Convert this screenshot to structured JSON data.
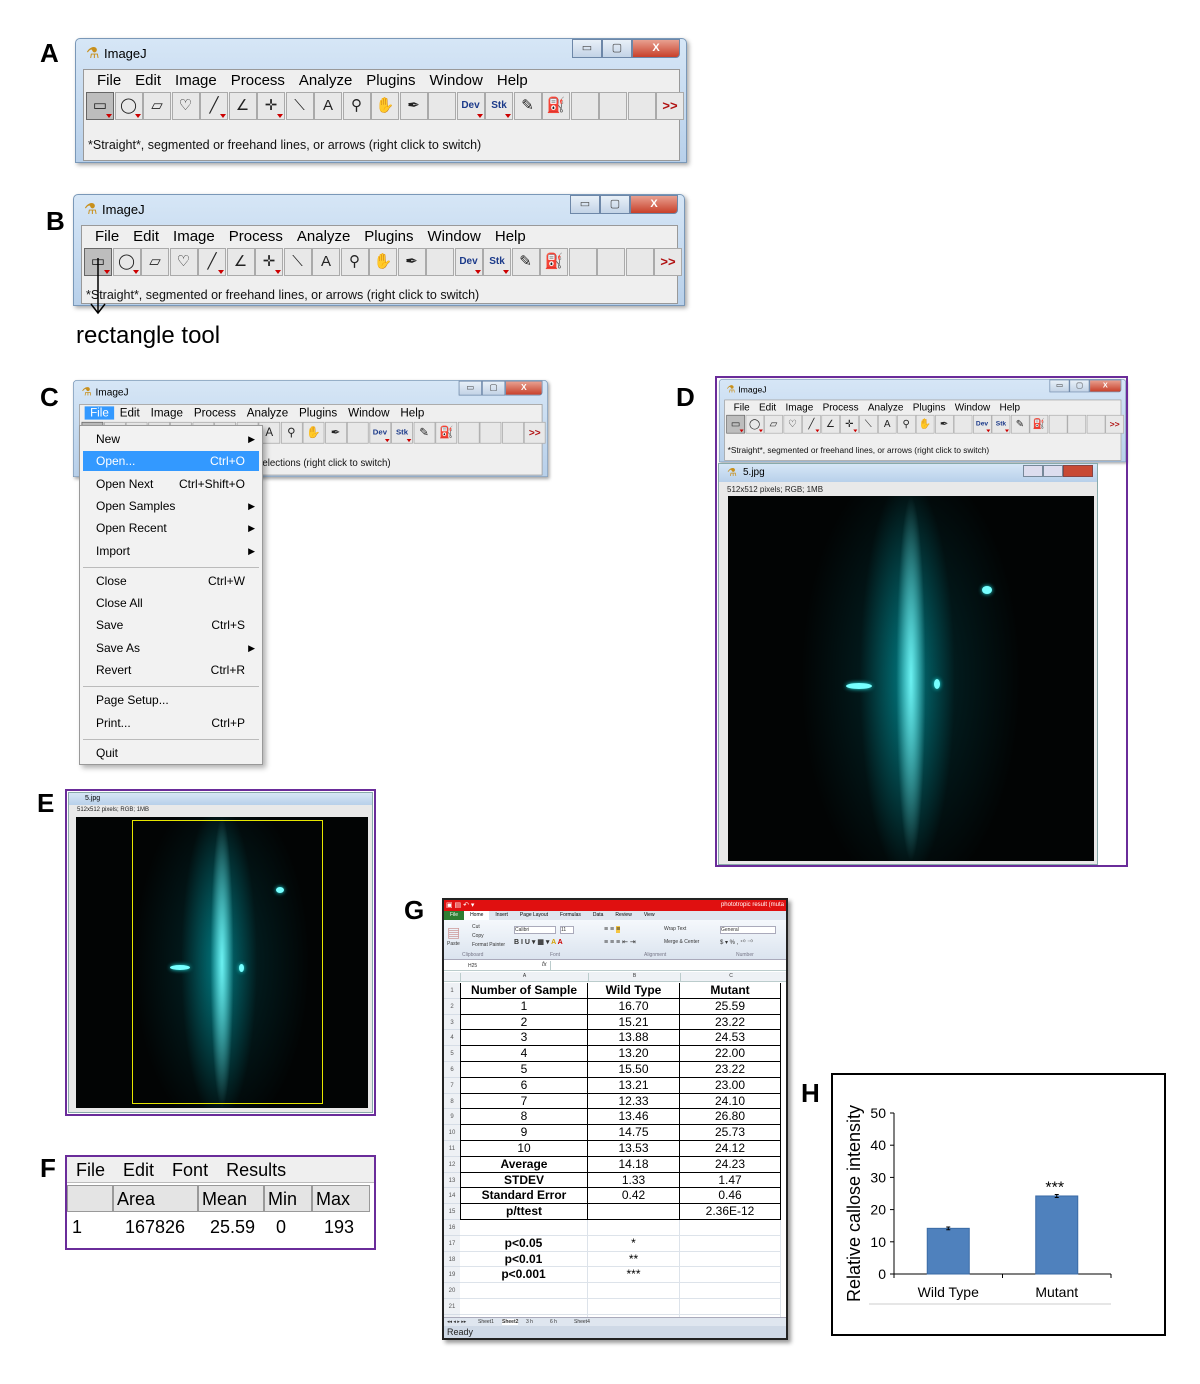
{
  "panel_labels": [
    "A",
    "B",
    "C",
    "D",
    "E",
    "G",
    "F",
    "H"
  ],
  "imagej": {
    "title": "ImageJ",
    "menu": [
      "File",
      "Edit",
      "Image",
      "Process",
      "Analyze",
      "Plugins",
      "Window",
      "Help"
    ],
    "window_buttons": {
      "minimize": "▭",
      "maximize": "▢",
      "close": "X"
    },
    "tools": [
      {
        "icon": "rectangle-icon",
        "glyph": "▭",
        "sub": true
      },
      {
        "icon": "oval-icon",
        "glyph": "◯",
        "sub": true
      },
      {
        "icon": "polygon-icon",
        "glyph": "▱"
      },
      {
        "icon": "freehand-icon",
        "glyph": "♡"
      },
      {
        "icon": "line-icon",
        "glyph": "╱",
        "sub": true
      },
      {
        "icon": "angle-icon",
        "glyph": "∠"
      },
      {
        "icon": "point-icon",
        "glyph": "✛",
        "sub": true
      },
      {
        "icon": "wand-icon",
        "glyph": "⟍"
      },
      {
        "icon": "text-icon",
        "glyph": "A"
      },
      {
        "icon": "magnifier-icon",
        "glyph": "⚲"
      },
      {
        "icon": "hand-icon",
        "glyph": "✋"
      },
      {
        "icon": "dropper-icon",
        "glyph": "✒"
      },
      {
        "icon": "blank-icon",
        "glyph": ""
      },
      {
        "icon": "dev-icon",
        "glyph": "Dev",
        "small": true,
        "sub": true
      },
      {
        "icon": "stk-icon",
        "glyph": "Stk",
        "small": true,
        "sub": true
      },
      {
        "icon": "brush-icon",
        "glyph": "✎"
      },
      {
        "icon": "bucket-icon",
        "glyph": "⛽"
      },
      {
        "icon": "blank-icon",
        "glyph": ""
      },
      {
        "icon": "blank-icon",
        "glyph": ""
      },
      {
        "icon": "blank-icon",
        "glyph": ""
      },
      {
        "icon": "more-tools-icon",
        "glyph": ">>",
        "red": true
      }
    ],
    "status": "*Straight*, segmented or freehand lines, or arrows (right click to switch)",
    "status_partial": "elections (right click to switch)"
  },
  "panel_b": {
    "annotation": "rectangle tool"
  },
  "file_menu": {
    "items": [
      {
        "label": "New",
        "shortcut": "",
        "submenu": true
      },
      {
        "label": "Open...",
        "shortcut": "Ctrl+O",
        "highlighted": true
      },
      {
        "label": "Open Next",
        "shortcut": "Ctrl+Shift+O"
      },
      {
        "label": "Open Samples",
        "shortcut": "",
        "submenu": true
      },
      {
        "label": "Open Recent",
        "shortcut": "",
        "submenu": true
      },
      {
        "label": "Import",
        "shortcut": "",
        "submenu": true
      },
      {
        "sep": true
      },
      {
        "label": "Close",
        "shortcut": "Ctrl+W"
      },
      {
        "label": "Close All",
        "shortcut": ""
      },
      {
        "label": "Save",
        "shortcut": "Ctrl+S"
      },
      {
        "label": "Save As",
        "shortcut": "",
        "submenu": true
      },
      {
        "label": "Revert",
        "shortcut": "Ctrl+R"
      },
      {
        "sep": true
      },
      {
        "label": "Page Setup...",
        "shortcut": ""
      },
      {
        "label": "Print...",
        "shortcut": "Ctrl+P"
      },
      {
        "sep": true
      },
      {
        "label": "Quit",
        "shortcut": ""
      }
    ]
  },
  "image_window": {
    "title": "5.jpg",
    "info": "512x512 pixels; RGB; 1MB"
  },
  "results": {
    "menu": [
      "File",
      "Edit",
      "Font",
      "Results"
    ],
    "headers": [
      "",
      "Area",
      "Mean",
      "Min",
      "Max"
    ],
    "rows": [
      [
        "1",
        "167826",
        "25.59",
        "0",
        "193"
      ]
    ]
  },
  "excel": {
    "title": "phototropic result (muta",
    "tabs": [
      "File",
      "Home",
      "Insert",
      "Page Layout",
      "Formulas",
      "Data",
      "Review",
      "View"
    ],
    "ribbon": {
      "paste": "Paste",
      "cut": "Cut",
      "copy": "Copy",
      "format_painter": "Format Painter",
      "clipboard": "Clipboard",
      "font_name": "Calibri",
      "font_size": "11",
      "font": "Font",
      "wrap": "Wrap Text",
      "merge": "Merge & Center",
      "alignment": "Alignment",
      "number_format": "General",
      "number": "Number"
    },
    "name_box": "H25",
    "fx": "fx",
    "columns": [
      "A",
      "B",
      "C"
    ],
    "rows": [
      [
        "Number of Sample",
        "Wild Type",
        "Mutant"
      ],
      [
        "1",
        "16.70",
        "25.59"
      ],
      [
        "2",
        "15.21",
        "23.22"
      ],
      [
        "3",
        "13.88",
        "24.53"
      ],
      [
        "4",
        "13.20",
        "22.00"
      ],
      [
        "5",
        "15.50",
        "23.22"
      ],
      [
        "6",
        "13.21",
        "23.00"
      ],
      [
        "7",
        "12.33",
        "24.10"
      ],
      [
        "8",
        "13.46",
        "26.80"
      ],
      [
        "9",
        "14.75",
        "25.73"
      ],
      [
        "10",
        "13.53",
        "24.12"
      ],
      [
        "Average",
        "14.18",
        "24.23"
      ],
      [
        "STDEV",
        "1.33",
        "1.47"
      ],
      [
        "Standard Error",
        "0.42",
        "0.46"
      ],
      [
        "p/ttest",
        "",
        "2.36E-12"
      ],
      [
        "",
        "",
        ""
      ],
      [
        "p<0.05",
        "*",
        ""
      ],
      [
        "p<0.01",
        "**",
        ""
      ],
      [
        "p<0.001",
        "***",
        ""
      ],
      [
        "",
        "",
        ""
      ],
      [
        "",
        "",
        ""
      ],
      [
        "",
        "",
        ""
      ]
    ],
    "sheets": [
      "Sheet1",
      "Sheet2",
      "3 h",
      "6 h",
      "Sheet4"
    ],
    "active_sheet": "Sheet2",
    "status": "Ready"
  },
  "chart_data": {
    "type": "bar",
    "categories": [
      "Wild Type",
      "Mutant"
    ],
    "values": [
      14.18,
      24.23
    ],
    "errors": [
      0.42,
      0.46
    ],
    "annotations": [
      "",
      "***"
    ],
    "ylabel": "Relative callose intensity",
    "xlabel": "",
    "ylim": [
      0,
      50
    ],
    "yticks": [
      0,
      10,
      20,
      30,
      40,
      50
    ],
    "bar_color": "#4f81bd",
    "grid": false
  }
}
